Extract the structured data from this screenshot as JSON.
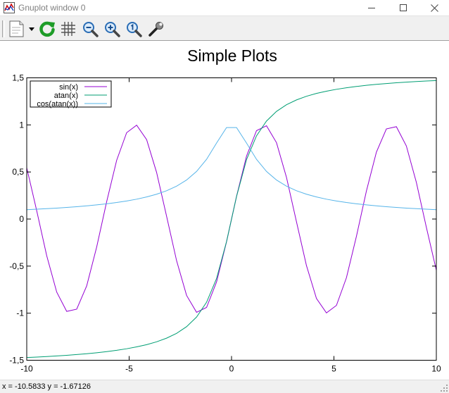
{
  "window": {
    "title": "Gnuplot window 0",
    "controls": [
      "minimize",
      "maximize",
      "close"
    ]
  },
  "toolbar": {
    "buttons": [
      {
        "name": "copy-print-menu",
        "icon": "page-icon"
      },
      {
        "name": "replot",
        "icon": "refresh-icon",
        "color": "#1e9c28"
      },
      {
        "name": "toggle-grid",
        "icon": "grid-icon"
      },
      {
        "name": "zoom-previous",
        "icon": "zoom-out-icon"
      },
      {
        "name": "zoom-next",
        "icon": "zoom-in-icon"
      },
      {
        "name": "autoscale",
        "icon": "zoom-reset-icon"
      },
      {
        "name": "options",
        "icon": "wrench-icon"
      }
    ]
  },
  "status": {
    "text": "x = -10.5833 y = -1.67126"
  },
  "chart_data": {
    "type": "line",
    "title": "Simple Plots",
    "xlabel": "",
    "ylabel": "",
    "xlim": [
      -10,
      10
    ],
    "ylim": [
      -1.5,
      1.5
    ],
    "xticks": [
      -10,
      -5,
      0,
      5,
      10
    ],
    "xtick_labels": [
      "-10",
      "-5",
      "0",
      "5",
      "10"
    ],
    "yticks": [
      -1.5,
      -1,
      -0.5,
      0,
      0.5,
      1,
      1.5
    ],
    "ytick_labels": [
      "-1,5",
      "-1",
      "-0,5",
      "0",
      "0,5",
      "1",
      "1,5"
    ],
    "grid": false,
    "legend_position": "top-left",
    "samples": 42,
    "series": [
      {
        "name": "sin(x)",
        "expr": "sin",
        "color": "#9400d3"
      },
      {
        "name": "atan(x)",
        "expr": "atan",
        "color": "#009e73"
      },
      {
        "name": "cos(atan(x))",
        "expr": "cos_atan",
        "color": "#56b4e9"
      }
    ]
  }
}
